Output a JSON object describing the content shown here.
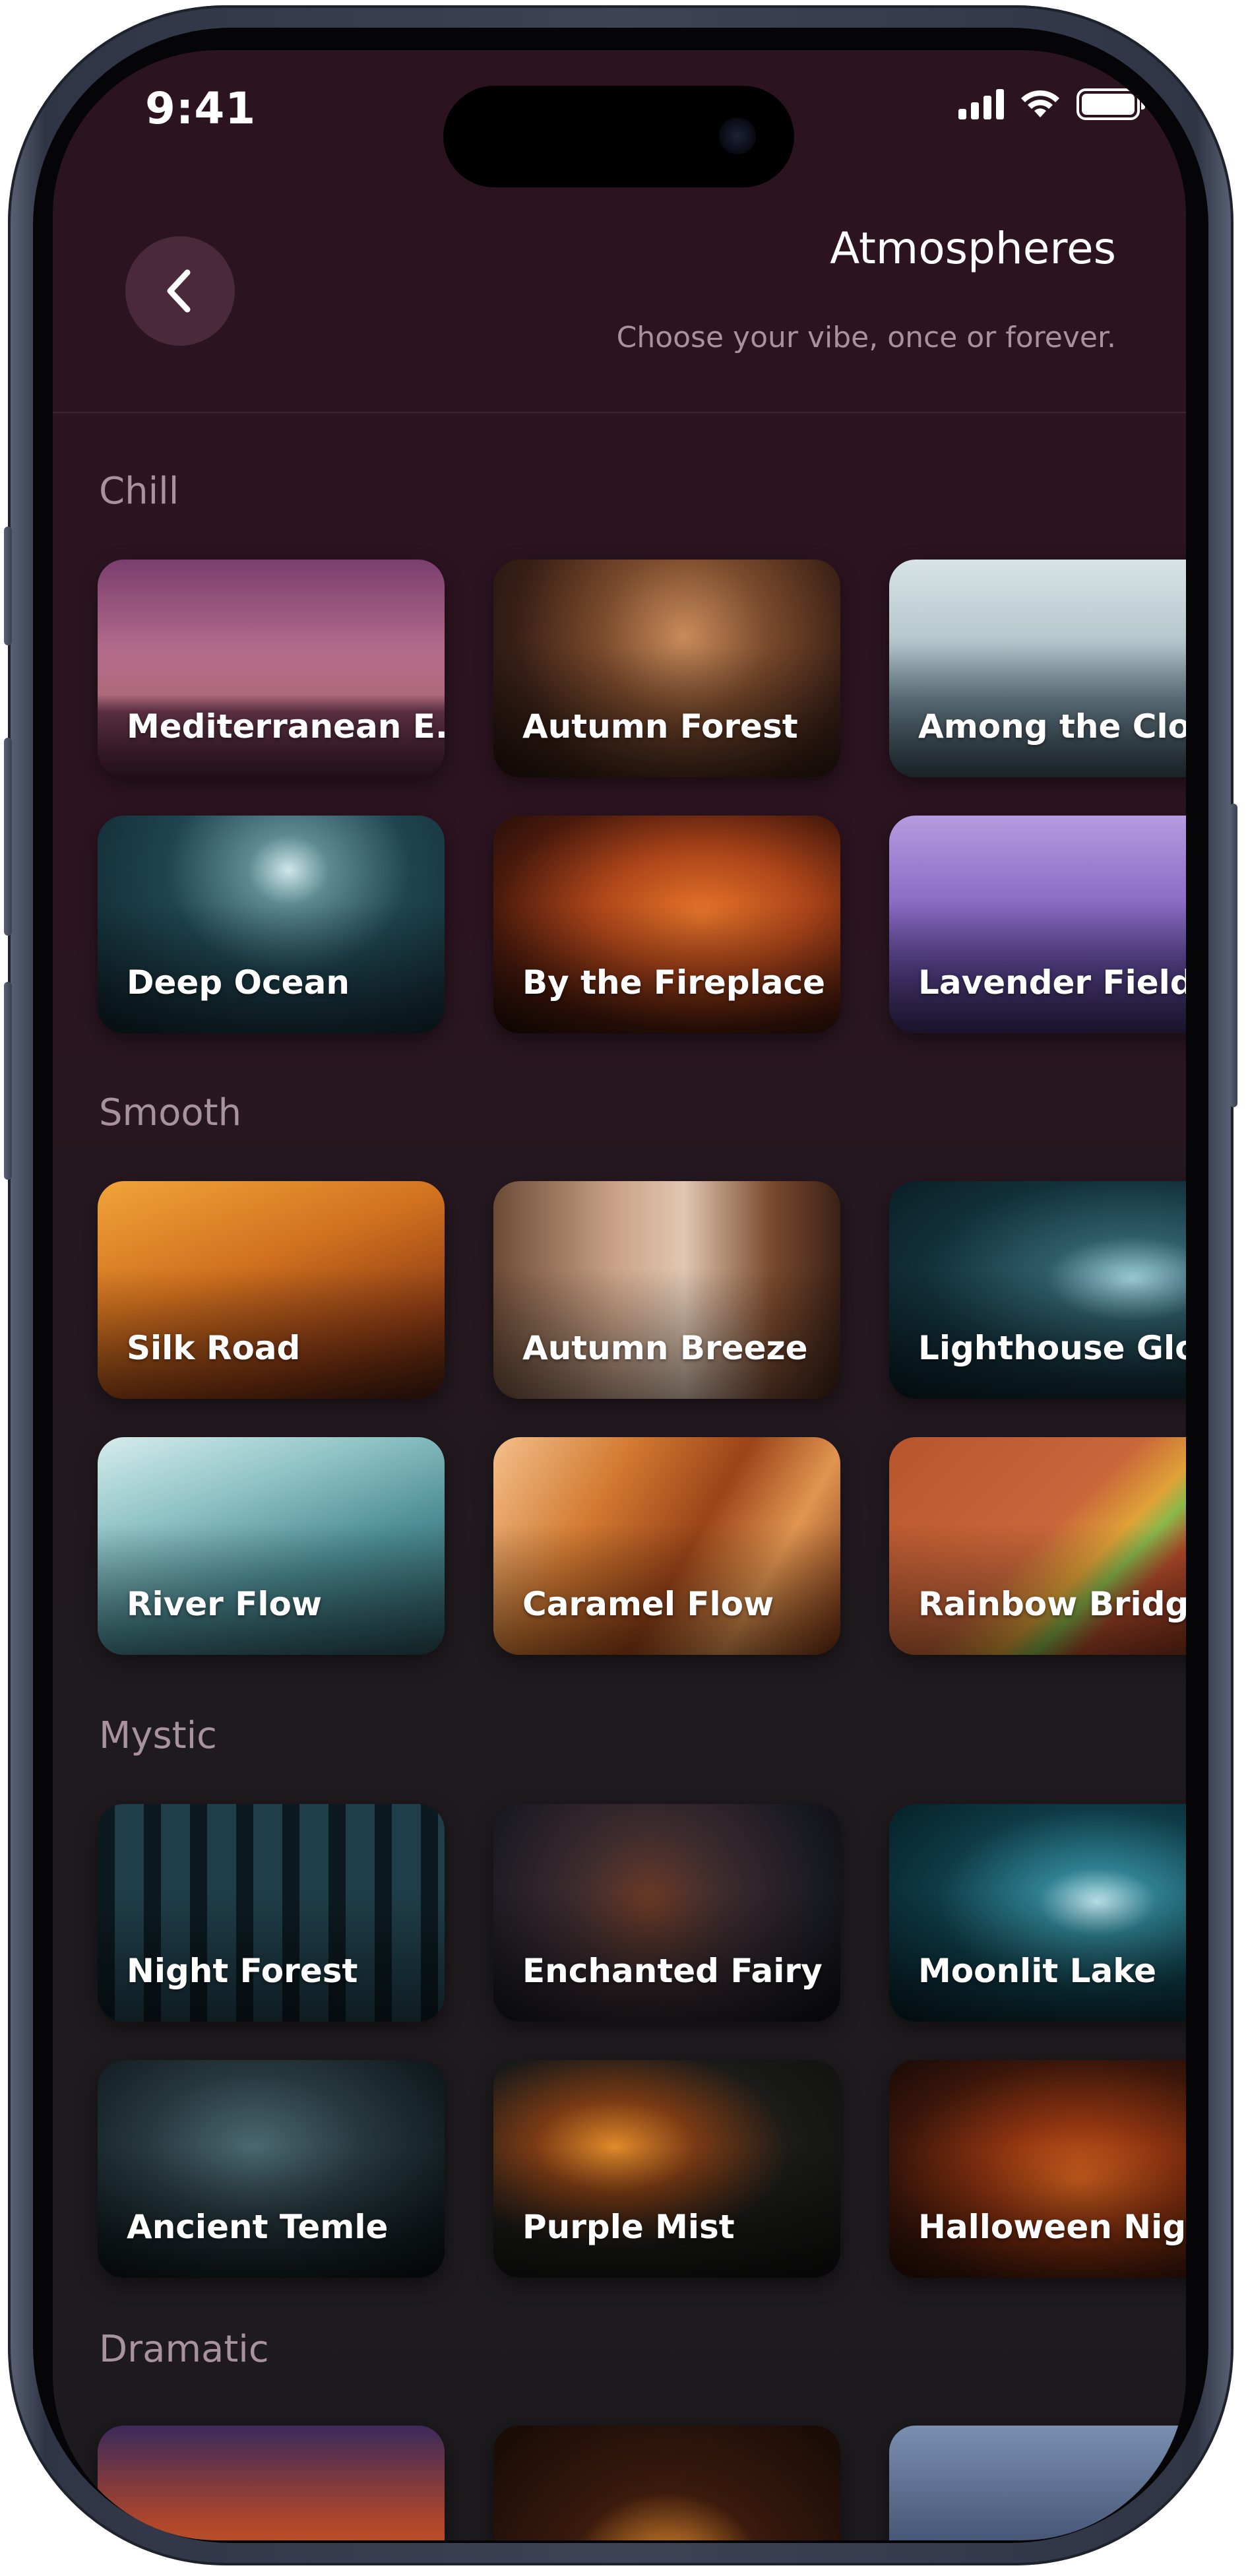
{
  "status_bar": {
    "time": "9:41"
  },
  "header": {
    "title": "Atmospheres",
    "subtitle": "Choose your vibe, once or forever."
  },
  "sections": [
    {
      "label": "Chill",
      "cards": [
        {
          "label": "Mediterranean E..."
        },
        {
          "label": "Autumn Forest"
        },
        {
          "label": "Among the Clouds"
        },
        {
          "label": "Deep Ocean"
        },
        {
          "label": "By the Fireplace"
        },
        {
          "label": "Lavender Field"
        }
      ]
    },
    {
      "label": "Smooth",
      "cards": [
        {
          "label": "Silk Road"
        },
        {
          "label": "Autumn Breeze"
        },
        {
          "label": "Lighthouse Glow"
        },
        {
          "label": "River Flow"
        },
        {
          "label": "Caramel Flow"
        },
        {
          "label": "Rainbow Bridge"
        }
      ]
    },
    {
      "label": "Mystic",
      "cards": [
        {
          "label": "Night Forest"
        },
        {
          "label": "Enchanted Fairy"
        },
        {
          "label": "Moonlit Lake"
        },
        {
          "label": "Ancient Temle"
        },
        {
          "label": "Purple Mist"
        },
        {
          "label": "Halloween Night"
        }
      ]
    },
    {
      "label": "Dramatic",
      "cards": []
    }
  ],
  "colors": {
    "background_top": "#2c1320",
    "background_bottom": "#1d1a1d",
    "accent_text": "#a8939d",
    "back_button": "#4a2a3a"
  },
  "icons": {
    "back": "chevron-left-icon",
    "signal": "cellular-signal-icon",
    "wifi": "wifi-icon",
    "battery": "battery-icon"
  }
}
